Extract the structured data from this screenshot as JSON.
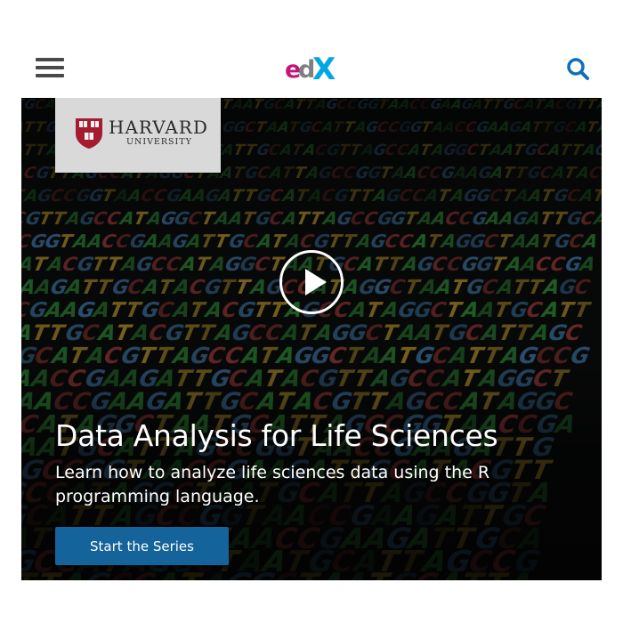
{
  "header": {
    "menu_icon": "hamburger-menu-icon",
    "logo_icon": "edx-logo",
    "logo_text": {
      "e": "e",
      "d": "d",
      "x": "X"
    },
    "search_icon": "search-icon",
    "colors": {
      "logo_e": "#c3167b",
      "logo_d": "#7d7f84",
      "logo_x": "#02a6e3",
      "search": "#0e6fb8",
      "menu": "#4a4a4a"
    }
  },
  "hero": {
    "partner": {
      "name": "HARVARD",
      "sub": "UNIVERSITY",
      "shield_icon": "veritas-shield-icon",
      "shield_lettering": "VERITAS"
    },
    "play_icon": "play-icon",
    "title": "Data Analysis for Life Sciences",
    "description": "Learn how to analyze life sciences data using the R programming language.",
    "cta_label": "Start the Series",
    "colors": {
      "cta": "#14639a",
      "text": "#ffffff"
    },
    "background_icon": "dna-sequence-background"
  }
}
